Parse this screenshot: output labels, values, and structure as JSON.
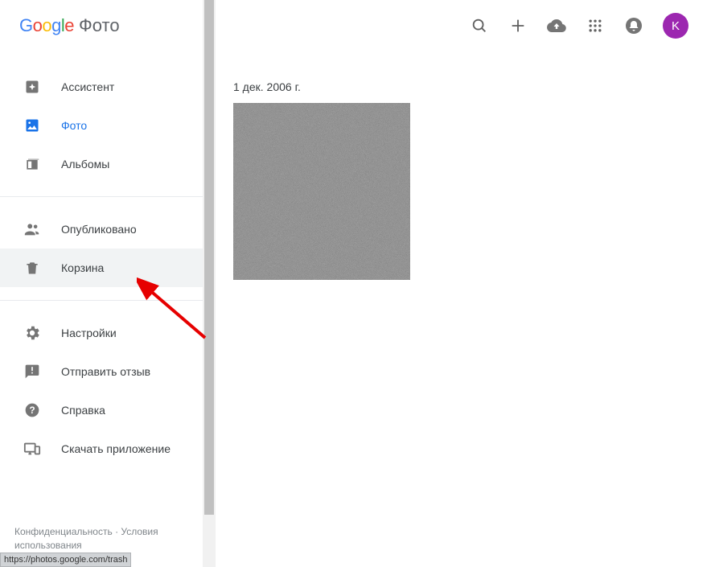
{
  "logo": {
    "g1": "G",
    "g2": "o",
    "g3": "o",
    "g4": "g",
    "g5": "l",
    "g6": "e",
    "product": "Фото"
  },
  "sidebar": {
    "items": [
      {
        "label": "Ассистент"
      },
      {
        "label": "Фото"
      },
      {
        "label": "Альбомы"
      },
      {
        "label": "Опубликовано"
      },
      {
        "label": "Корзина"
      },
      {
        "label": "Настройки"
      },
      {
        "label": "Отправить отзыв"
      },
      {
        "label": "Справка"
      },
      {
        "label": "Скачать приложение"
      }
    ]
  },
  "footer": {
    "privacy": "Конфиденциальность",
    "sep": " · ",
    "terms": "Условия использования"
  },
  "avatar_letter": "K",
  "main": {
    "date": "1 дек. 2006 г."
  },
  "status_url": "https://photos.google.com/trash"
}
